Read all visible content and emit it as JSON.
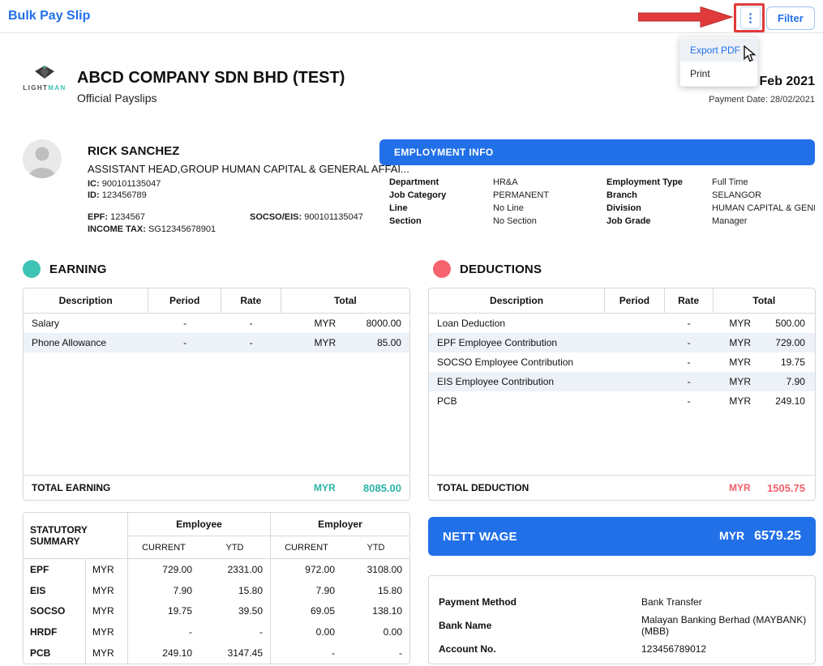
{
  "colors": {
    "accent_blue": "#2170e8",
    "teal": "#3fc3b5",
    "teal_text": "#2bb3a6",
    "red": "#f4636e",
    "red_text": "#f0616c",
    "arrow_red": "#e03a3a"
  },
  "page": {
    "title": "Bulk Pay Slip",
    "filter_label": "Filter",
    "kebab_icon": "⋮"
  },
  "menu": {
    "items": [
      {
        "label": "Export PDF"
      },
      {
        "label": "Print"
      }
    ]
  },
  "company": {
    "logo_light": "LIGHT",
    "logo_man": "MAN",
    "name": "ABCD COMPANY SDN BHD (TEST)",
    "subtitle": "Official Payslips",
    "period": "Feb 2021",
    "payment_date": "Payment Date: 28/02/2021"
  },
  "employee": {
    "name": "RICK SANCHEZ",
    "position": "ASSISTANT HEAD,GROUP HUMAN CAPITAL & GENERAL AFFAI...",
    "ic_label": "IC:",
    "ic": "900101135047",
    "id_label": "ID:",
    "id": "123456789",
    "epf_label": "EPF:",
    "epf": "1234567",
    "socso_label": "SOCSO/EIS:",
    "socso": "900101135047",
    "tax_label": "INCOME TAX:",
    "tax": "SG12345678901"
  },
  "employment_info": {
    "title": "EMPLOYMENT INFO",
    "left": [
      {
        "label": "Department",
        "value": "HR&A"
      },
      {
        "label": "Job Category",
        "value": "PERMANENT"
      },
      {
        "label": "Line",
        "value": "No Line"
      },
      {
        "label": "Section",
        "value": "No Section"
      }
    ],
    "right": [
      {
        "label": "Employment Type",
        "value": "Full Time"
      },
      {
        "label": "Branch",
        "value": "SELANGOR"
      },
      {
        "label": "Division",
        "value": "HUMAN CAPITAL & GENE..."
      },
      {
        "label": "Job Grade",
        "value": "Manager"
      }
    ]
  },
  "earning": {
    "title": "EARNING",
    "headers": [
      "Description",
      "Period",
      "Rate",
      "Total"
    ],
    "rows": [
      {
        "desc": "Salary",
        "period": "-",
        "rate": "-",
        "cur": "MYR",
        "total": "8000.00"
      },
      {
        "desc": "Phone Allowance",
        "period": "-",
        "rate": "-",
        "cur": "MYR",
        "total": "85.00"
      }
    ],
    "total_label": "TOTAL EARNING",
    "total_cur": "MYR",
    "total": "8085.00"
  },
  "deductions": {
    "title": "DEDUCTIONS",
    "headers": [
      "Description",
      "Period",
      "Rate",
      "Total"
    ],
    "rows": [
      {
        "desc": "Loan Deduction",
        "period": "",
        "rate": "-",
        "cur": "MYR",
        "total": "500.00"
      },
      {
        "desc": "EPF Employee Contribution",
        "period": "",
        "rate": "-",
        "cur": "MYR",
        "total": "729.00"
      },
      {
        "desc": "SOCSO Employee Contribution",
        "period": "",
        "rate": "-",
        "cur": "MYR",
        "total": "19.75"
      },
      {
        "desc": "EIS Employee Contribution",
        "period": "",
        "rate": "-",
        "cur": "MYR",
        "total": "7.90"
      },
      {
        "desc": "PCB",
        "period": "",
        "rate": "-",
        "cur": "MYR",
        "total": "249.10"
      }
    ],
    "total_label": "TOTAL DEDUCTION",
    "total_cur": "MYR",
    "total": "1505.75"
  },
  "statutory": {
    "title": "STATUTORY SUMMARY",
    "employee_header": "Employee",
    "employer_header": "Employer",
    "sub_headers": [
      "CURRENT",
      "YTD",
      "CURRENT",
      "YTD"
    ],
    "rows": [
      {
        "label": "EPF",
        "cur": "MYR",
        "values": [
          "729.00",
          "2331.00",
          "972.00",
          "3108.00"
        ]
      },
      {
        "label": "EIS",
        "cur": "MYR",
        "values": [
          "7.90",
          "15.80",
          "7.90",
          "15.80"
        ]
      },
      {
        "label": "SOCSO",
        "cur": "MYR",
        "values": [
          "19.75",
          "39.50",
          "69.05",
          "138.10"
        ]
      },
      {
        "label": "HRDF",
        "cur": "MYR",
        "values": [
          "-",
          "-",
          "0.00",
          "0.00"
        ]
      },
      {
        "label": "PCB",
        "cur": "MYR",
        "values": [
          "249.10",
          "3147.45",
          "-",
          "-"
        ]
      }
    ]
  },
  "nett_wage": {
    "label": "NETT WAGE",
    "cur": "MYR",
    "amount": "6579.25"
  },
  "payment": {
    "rows": [
      {
        "label": "Payment Method",
        "value": "Bank Transfer"
      },
      {
        "label": "Bank Name",
        "value": "Malayan Banking Berhad (MAYBANK) (MBB)"
      },
      {
        "label": "Account No.",
        "value": "123456789012"
      }
    ]
  }
}
